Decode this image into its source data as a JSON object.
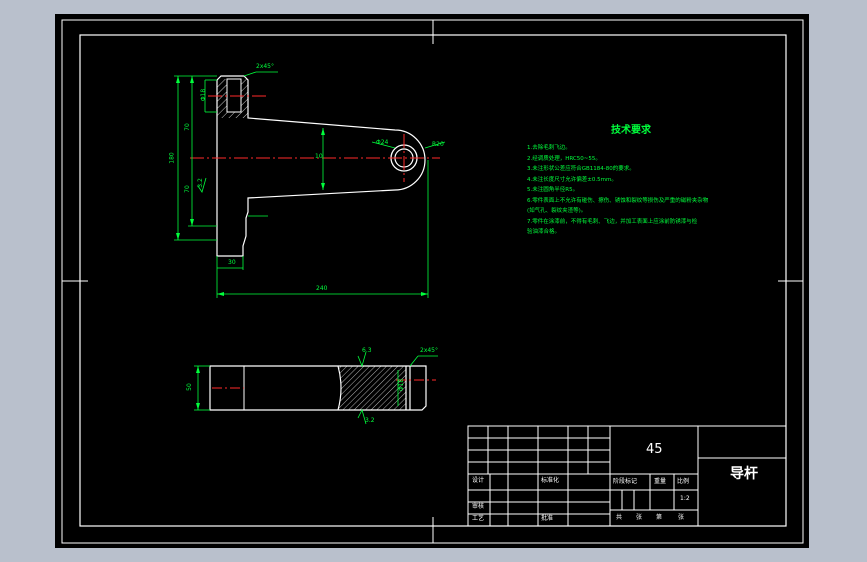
{
  "title_block": {
    "material": "45",
    "part_name": "导杆",
    "design_label": "设计",
    "standardize_label": "标准化",
    "review_label": "审核",
    "process_label": "工艺",
    "approve_label": "批准",
    "stage_mark_label": "阶段标记",
    "weight_label": "重量",
    "scale_label": "比例",
    "scale_value": "1:2",
    "sheet_total_label": "共",
    "sheet_total_unit": "张",
    "sheet_label": "第",
    "sheet_unit": "张"
  },
  "tech_requirements": {
    "title": "技术要求",
    "items": [
      "1.去除毛刺飞边。",
      "2.经调质处理，HRC50~55。",
      "3.未注形状公差应符合GB1184-80的要求。",
      "4.未注长度尺寸允许偏差±0.5mm。",
      "5.未注圆角半径R5。",
      "6.零件表面上不允许有碰伤、擦伤、锈蚀和裂纹等损伤及严重的磁粉夹杂物",
      "(如气孔、裂纹夹渣等)。",
      "7.零件在涂漆前，不得有毛刺、飞边，并加工表面上应涂前防锈漆与检",
      "验油漆合格。"
    ]
  },
  "dimensions": {
    "chamfer_top": "2x45°",
    "chamfer_side": "2x45°",
    "d_small_top": "Φ18",
    "d70_top": "70",
    "d70_bottom": "70",
    "d180": "180",
    "d10": "10",
    "d_hole": "Φ24",
    "r_end": "R20",
    "d240": "240",
    "d30": "30",
    "d32": "3.2",
    "d_side_50": "50",
    "d_side_h18": "Φ18",
    "rough_top": "6.3",
    "rough_bottom": "3.2"
  }
}
